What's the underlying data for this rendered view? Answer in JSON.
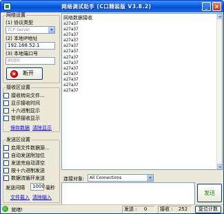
{
  "titlebar": {
    "title": "网络调试助手 (C口精装版 V3.8.2)",
    "minimize_glyph": "_",
    "close_glyph": "×"
  },
  "net_settings": {
    "legend": "网络设置",
    "protocol_label": "(1) 协议类型",
    "protocol_value": "TCP Server",
    "ip_label": "(2) 本地IP地址",
    "ip_value": "192.168.52.1",
    "port_label": "(3) 本地端口号",
    "port_value": "8080",
    "connect_button": "断开"
  },
  "recv_settings": {
    "legend": "接收区设置",
    "options": [
      "接收转向文件...",
      "显示接收时间",
      "十六进制显示",
      "暂停接收显示"
    ],
    "save_link": "保存数据",
    "clear_link": "清除显示"
  },
  "send_settings": {
    "legend": "发送区设置",
    "options": [
      "启用文件数据源...",
      "自动发送附加位",
      "发送完自动清空",
      "按十六进制发送",
      "数据流循环发送"
    ],
    "interval_label": "发送间隔",
    "interval_value": "1000",
    "interval_unit": "毫秒",
    "load_file_link": "文件载入",
    "clear_input_link": "清除输入"
  },
  "receive_area": {
    "legend": "网络数据接收",
    "lines": [
      "a27a37",
      "a27a37",
      "a27a37",
      "a27a37",
      "a27a37",
      "a27a37",
      "a27a37",
      "a27a37",
      "a27a37",
      "a27a37",
      "a27a37",
      "a27a37",
      "a27a37"
    ]
  },
  "send_bar": {
    "target_label": "连接对象:",
    "target_value": "All Connections",
    "send_button": "发送"
  },
  "status_bar": {
    "status_text": "就绪!",
    "sent_label": "发送 :",
    "sent_count": "0",
    "recv_label": "接收 :",
    "recv_count": "252",
    "reset_button": "复位计数"
  },
  "colors": {
    "titlebar_blue": "#0a5bd8",
    "link_blue": "#0000ff",
    "send_green": "#118811"
  }
}
